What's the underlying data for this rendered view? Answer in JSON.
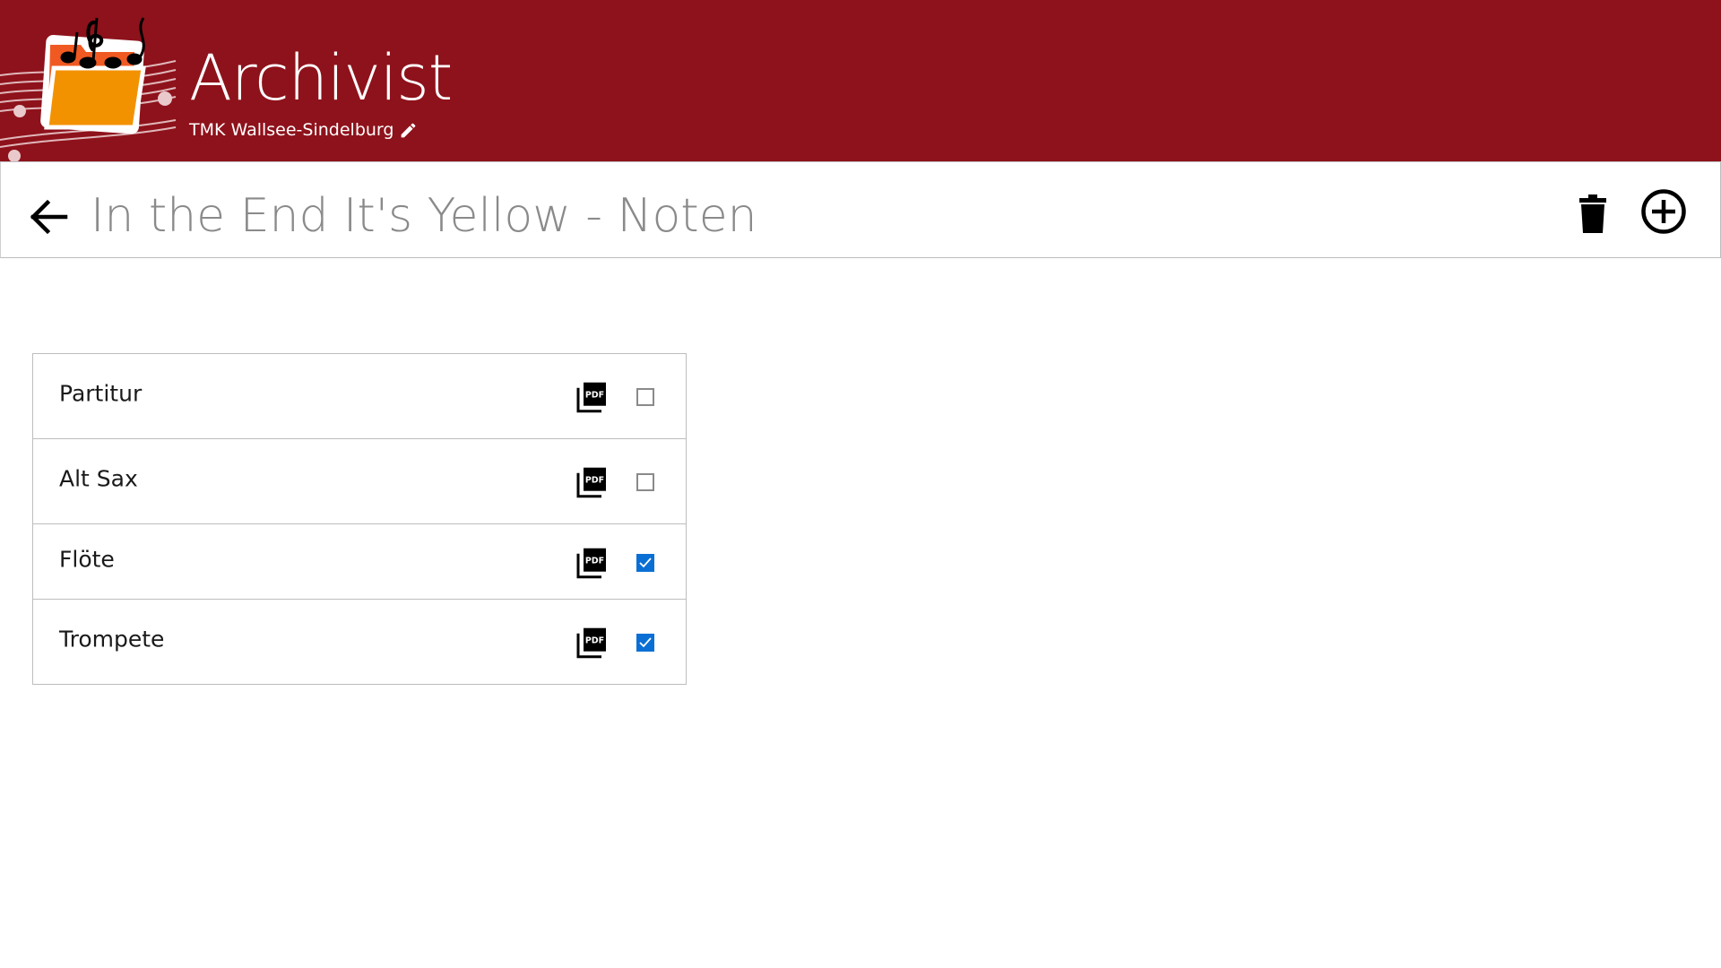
{
  "app": {
    "title": "Archivist",
    "organization": "TMK Wallsee-Sindelburg",
    "accent_color": "#8e121b",
    "logo_icon": "folder-music-logo"
  },
  "header": {
    "page_title": "In the End It's Yellow - Noten",
    "back_icon": "arrow-left-icon",
    "delete_icon": "trash-icon",
    "add_icon": "plus-circle-icon"
  },
  "parts": [
    {
      "label": "Partitur",
      "checked": false,
      "icon": "pdf-icon"
    },
    {
      "label": "Alt Sax",
      "checked": false,
      "icon": "pdf-icon"
    },
    {
      "label": "Flöte",
      "checked": true,
      "icon": "pdf-icon"
    },
    {
      "label": "Trompete",
      "checked": true,
      "icon": "pdf-icon"
    }
  ],
  "checkbox_checked_color": "#0a6fd4"
}
